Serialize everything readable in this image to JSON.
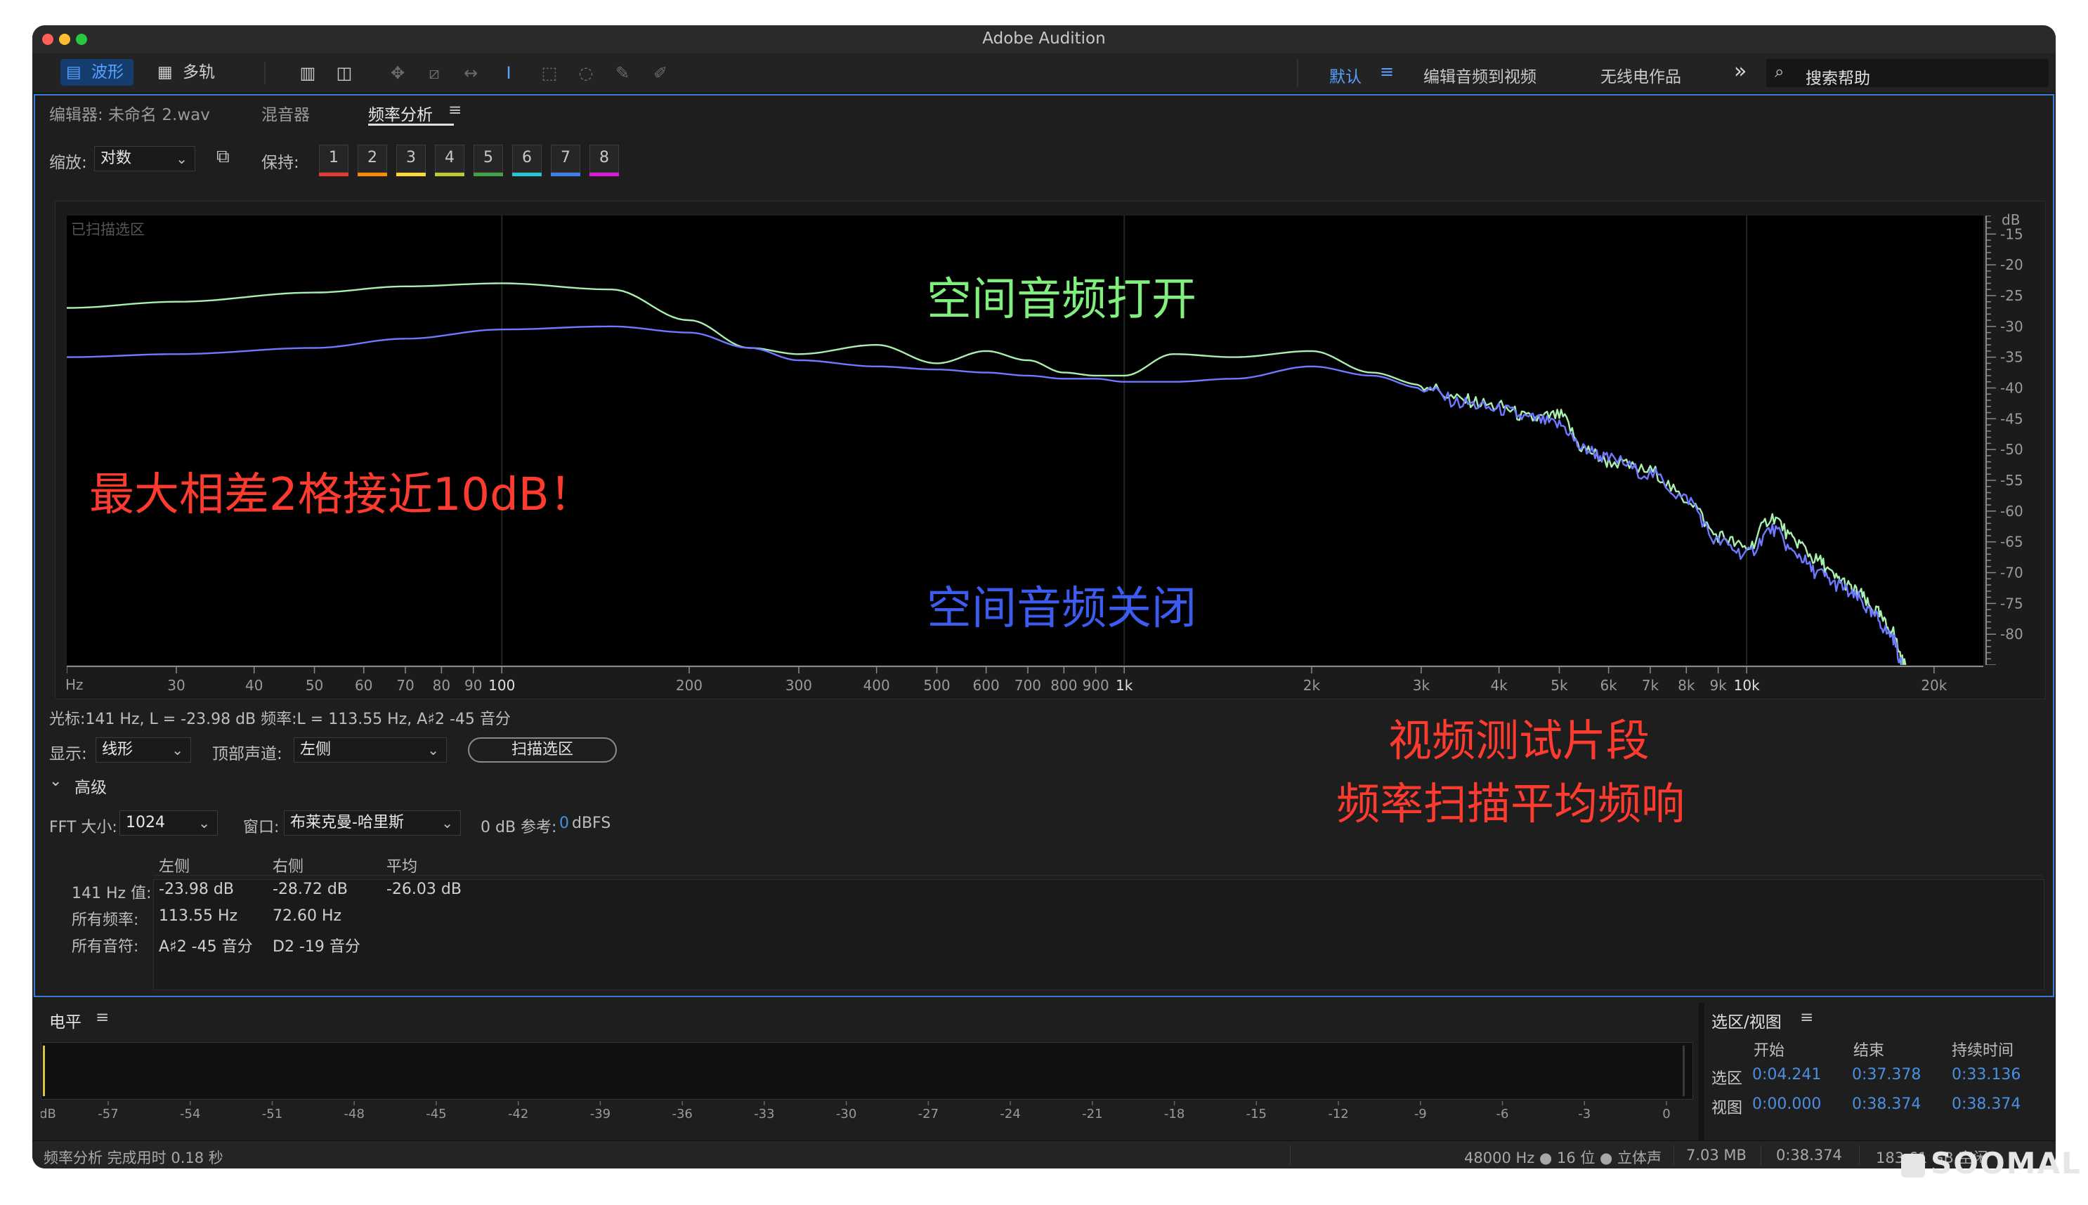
{
  "window": {
    "title": "Adobe Audition"
  },
  "toolbar": {
    "waveform_label": "波形",
    "multitrack_label": "多轨",
    "workspaces": [
      "默认",
      "编辑音频到视频",
      "无线电作品"
    ],
    "more": "»",
    "search_placeholder": "搜索帮助"
  },
  "tabs": {
    "editor": "编辑器: 未命名 2.wav",
    "mixer": "混音器",
    "freq": "频率分析",
    "menu": "≡"
  },
  "controls": {
    "zoom_label": "缩放:",
    "zoom_value": "对数",
    "hold_label": "保持:",
    "holds": [
      {
        "n": "1",
        "color": "#e53935"
      },
      {
        "n": "2",
        "color": "#fb8c00"
      },
      {
        "n": "3",
        "color": "#fdd835"
      },
      {
        "n": "4",
        "color": "#c0ca33"
      },
      {
        "n": "5",
        "color": "#43a047"
      },
      {
        "n": "6",
        "color": "#26c6da"
      },
      {
        "n": "7",
        "color": "#3f7ee8"
      },
      {
        "n": "8",
        "color": "#d81bd8"
      }
    ]
  },
  "plot": {
    "scanned_label": "已扫描选区",
    "db_unit": "dB",
    "hz_unit": "Hz"
  },
  "chart_data": {
    "type": "line",
    "xlabel": "Hz",
    "ylabel": "dB",
    "x_scale": "log",
    "xlim": [
      20,
      24000
    ],
    "ylim": [
      -85,
      -12
    ],
    "x_ticks": [
      {
        "v": 30,
        "label": "30"
      },
      {
        "v": 40,
        "label": "40"
      },
      {
        "v": 50,
        "label": "50"
      },
      {
        "v": 60,
        "label": "60"
      },
      {
        "v": 70,
        "label": "70"
      },
      {
        "v": 80,
        "label": "80"
      },
      {
        "v": 90,
        "label": "90"
      },
      {
        "v": 100,
        "label": "100"
      },
      {
        "v": 200,
        "label": "200"
      },
      {
        "v": 300,
        "label": "300"
      },
      {
        "v": 400,
        "label": "400"
      },
      {
        "v": 500,
        "label": "500"
      },
      {
        "v": 600,
        "label": "600"
      },
      {
        "v": 700,
        "label": "700"
      },
      {
        "v": 800,
        "label": "800"
      },
      {
        "v": 900,
        "label": "900"
      },
      {
        "v": 1000,
        "label": "1k"
      },
      {
        "v": 2000,
        "label": "2k"
      },
      {
        "v": 3000,
        "label": "3k"
      },
      {
        "v": 4000,
        "label": "4k"
      },
      {
        "v": 5000,
        "label": "5k"
      },
      {
        "v": 6000,
        "label": "6k"
      },
      {
        "v": 7000,
        "label": "7k"
      },
      {
        "v": 8000,
        "label": "8k"
      },
      {
        "v": 9000,
        "label": "9k"
      },
      {
        "v": 10000,
        "label": "10k"
      },
      {
        "v": 20000,
        "label": "20k"
      }
    ],
    "y_ticks": [
      -15,
      -20,
      -25,
      -30,
      -35,
      -40,
      -45,
      -50,
      -55,
      -60,
      -65,
      -70,
      -75,
      -80
    ],
    "series": [
      {
        "name": "空间音频打开",
        "color": "#a8f0b0",
        "x": [
          20,
          30,
          50,
          70,
          100,
          150,
          200,
          250,
          300,
          400,
          500,
          600,
          700,
          800,
          900,
          1000,
          1200,
          1500,
          2000,
          2500,
          3000,
          3500,
          4000,
          4500,
          5000,
          5500,
          6000,
          7000,
          8000,
          9000,
          10000,
          11000,
          12000,
          13000,
          14000,
          15000,
          16000,
          17000,
          18000
        ],
        "y": [
          -27,
          -26,
          -24.5,
          -23.5,
          -23,
          -24,
          -29,
          -33.5,
          -34.5,
          -33,
          -36,
          -34,
          -35.5,
          -37.5,
          -38,
          -38,
          -34.5,
          -35,
          -34,
          -37.5,
          -39.5,
          -42,
          -43,
          -45,
          -44.5,
          -50,
          -52,
          -53.5,
          -58,
          -64,
          -66,
          -61,
          -65,
          -68,
          -71,
          -73,
          -76,
          -79,
          -85
        ]
      },
      {
        "name": "空间音频关闭",
        "color": "#6f78ff",
        "x": [
          20,
          30,
          50,
          70,
          100,
          150,
          200,
          250,
          300,
          400,
          500,
          600,
          700,
          800,
          900,
          1000,
          1200,
          1500,
          2000,
          2500,
          3000,
          3500,
          4000,
          4500,
          5000,
          5500,
          6000,
          7000,
          8000,
          9000,
          10000,
          11000,
          12000,
          13000,
          14000,
          15000,
          16000,
          17000,
          18000
        ],
        "y": [
          -35,
          -34.5,
          -33.5,
          -32,
          -30.5,
          -30,
          -31,
          -33.5,
          -35.5,
          -36.5,
          -37,
          -37.5,
          -38,
          -38.5,
          -38.5,
          -39,
          -39,
          -38.5,
          -36.5,
          -38,
          -40,
          -42.5,
          -43.5,
          -45,
          -46,
          -50,
          -51.5,
          -54,
          -58,
          -65,
          -67,
          -63,
          -67,
          -70,
          -72,
          -74,
          -77,
          -80,
          -86
        ]
      }
    ]
  },
  "annotations": {
    "on": "空间音频打开",
    "off": "空间音频关闭",
    "diff": "最大相差2格接近10dB！",
    "note1": "视频测试片段",
    "note2": "频率扫描平均频响"
  },
  "cursor": {
    "text": "光标:141 Hz,  L = -23.98 dB  频率:L = 113.55 Hz,  A♯2 -45 音分"
  },
  "display": {
    "display_label": "显示:",
    "display_value": "线形",
    "channel_label": "顶部声道:",
    "channel_value": "左侧",
    "scan_button": "扫描选区"
  },
  "advanced": {
    "title": "高级",
    "fft_label": "FFT 大小:",
    "fft_value": "1024",
    "window_label": "窗口:",
    "window_value": "布莱克曼-哈里斯",
    "ref_label": "0 dB 参考:",
    "ref_value": "0",
    "ref_unit": "dBFS"
  },
  "table": {
    "headers": [
      "左侧",
      "右侧",
      "平均"
    ],
    "rows": [
      {
        "label": "141 Hz 值:",
        "cells": [
          "-23.98 dB",
          "-28.72 dB",
          "-26.03 dB"
        ]
      },
      {
        "label": "所有频率:",
        "cells": [
          "113.55 Hz",
          "72.60 Hz",
          ""
        ]
      },
      {
        "label": "所有音符:",
        "cells": [
          "A♯2 -45 音分",
          "D2 -19 音分",
          ""
        ]
      }
    ]
  },
  "levels": {
    "title": "电平",
    "menu": "≡",
    "scale": [
      "dB",
      "-57",
      "-54",
      "-51",
      "-48",
      "-45",
      "-42",
      "-39",
      "-36",
      "-33",
      "-30",
      "-27",
      "-24",
      "-21",
      "-18",
      "-15",
      "-12",
      "-9",
      "-6",
      "-3",
      "0"
    ]
  },
  "selection": {
    "title": "选区/视图",
    "menu": "≡",
    "cols": [
      "开始",
      "结束",
      "持续时间"
    ],
    "rows": [
      {
        "label": "选区",
        "values": [
          "0:04.241",
          "0:37.378",
          "0:33.136"
        ]
      },
      {
        "label": "视图",
        "values": [
          "0:00.000",
          "0:38.374",
          "0:38.374"
        ]
      }
    ]
  },
  "status": {
    "left": "频率分析 完成用时 0.18 秒",
    "format": "48000 Hz ● 16 位 ● 立体声",
    "size": "7.03 MB",
    "duration": "0:38.374",
    "free": "183.61 GB 空闲"
  },
  "watermark": "SOOMAL"
}
